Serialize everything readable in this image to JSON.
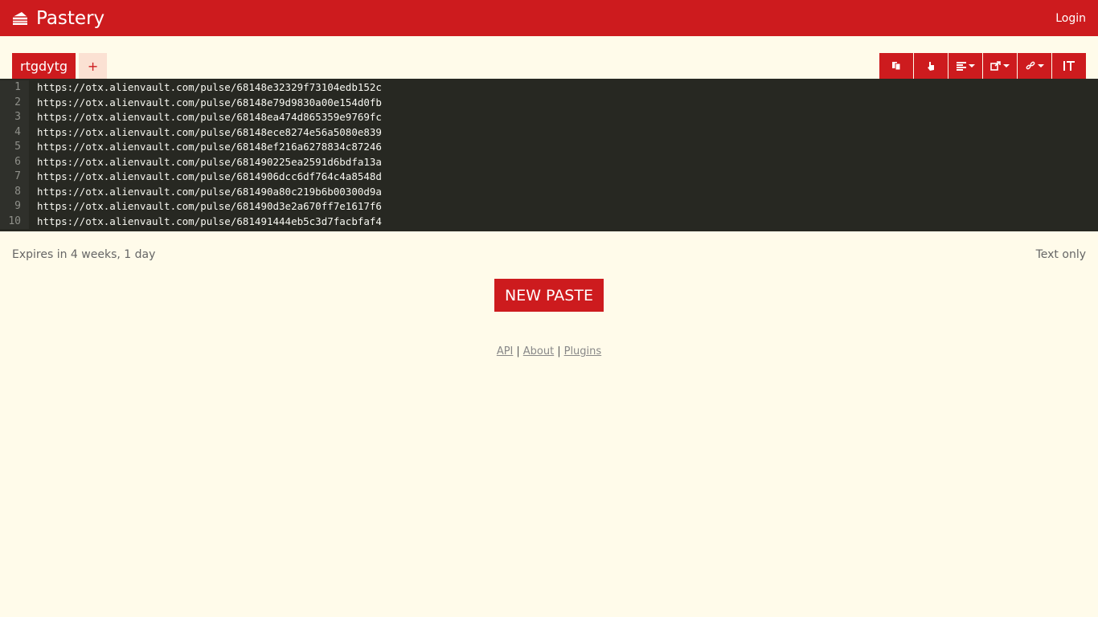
{
  "header": {
    "brand": "Pastery",
    "login_label": "Login"
  },
  "tabs": [
    {
      "label": "rtgdytg",
      "active": true
    },
    {
      "label": "+",
      "active": false
    }
  ],
  "toolbar": {
    "buttons": [
      {
        "icon": "copy-icon"
      },
      {
        "icon": "hand-pointer-icon"
      },
      {
        "icon": "align-left-icon",
        "dropdown": true
      },
      {
        "icon": "share-icon",
        "dropdown": true
      },
      {
        "icon": "link-icon",
        "dropdown": true
      },
      {
        "icon": "text-size-icon"
      }
    ]
  },
  "code": {
    "line_numbers": [
      "1",
      "2",
      "3",
      "4",
      "5",
      "6",
      "7",
      "8",
      "9",
      "10"
    ],
    "lines": [
      "https://otx.alienvault.com/pulse/68148e32329f73104edb152c",
      "https://otx.alienvault.com/pulse/68148e79d9830a00e154d0fb",
      "https://otx.alienvault.com/pulse/68148ea474d865359e9769fc",
      "https://otx.alienvault.com/pulse/68148ece8274e56a5080e839",
      "https://otx.alienvault.com/pulse/68148ef216a6278834c87246",
      "https://otx.alienvault.com/pulse/681490225ea2591d6bdfa13a",
      "https://otx.alienvault.com/pulse/6814906dcc6df764c4a8548d",
      "https://otx.alienvault.com/pulse/681490a80c219b6b00300d9a",
      "https://otx.alienvault.com/pulse/681490d3e2a670ff7e1617f6",
      "https://otx.alienvault.com/pulse/681491444eb5c3d7facbfaf4"
    ]
  },
  "meta": {
    "expires": "Expires in 4 weeks, 1 day",
    "language": "Text only"
  },
  "new_paste_label": "NEW PASTE",
  "footer": {
    "api": "API",
    "about": "About",
    "plugins": "Plugins",
    "separator": "|"
  },
  "colors": {
    "brand_red": "#cd1b1e",
    "background": "#fffbea",
    "code_bg": "#272822"
  }
}
